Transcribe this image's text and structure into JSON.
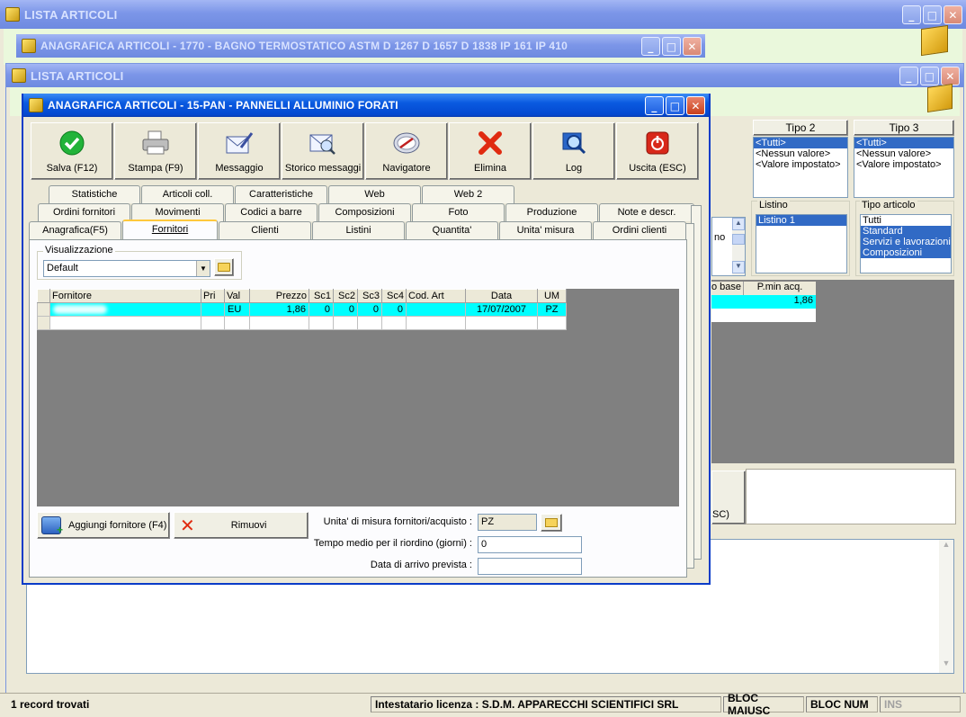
{
  "window_back": {
    "title": "LISTA ARTICOLI"
  },
  "window_mid": {
    "title": "ANAGRAFICA ARTICOLI - 1770 - BAGNO TERMOSTATICO ASTM D 1267 D 1657 D 1838 IP 161 IP 410"
  },
  "window_list": {
    "title": "LISTA ARTICOLI",
    "tipo2": {
      "label": "Tipo 2",
      "items": [
        "<Tutti>",
        "<Nessun valore>",
        "<Valore impostato>"
      ],
      "selected": 0
    },
    "tipo3": {
      "label": "Tipo 3",
      "items": [
        "<Tutti>",
        "<Nessun valore>",
        "<Valore impostato>"
      ],
      "selected": 0
    },
    "listino": {
      "label": "Listino",
      "items": [
        "Listino 1"
      ]
    },
    "tipo_articolo": {
      "label": "Tipo articolo",
      "items": [
        "Tutti",
        "Standard",
        "Servizi e lavorazioni",
        "Composizioni"
      ]
    },
    "partial_text": "no",
    "grid_headers": [
      "o base",
      "P.min acq."
    ],
    "grid_value": "1,86",
    "partial_button": "SC)"
  },
  "window_front": {
    "title": "ANAGRAFICA ARTICOLI - 15-PAN - PANNELLI ALLUMINIO FORATI",
    "toolbar": [
      {
        "label": "Salva (F12)",
        "icon": "check-icon"
      },
      {
        "label": "Stampa (F9)",
        "icon": "printer-icon"
      },
      {
        "label": "Messaggio",
        "icon": "envelope-pen-icon"
      },
      {
        "label": "Storico messaggi",
        "icon": "envelope-search-icon"
      },
      {
        "label": "Navigatore",
        "icon": "compass-icon"
      },
      {
        "label": "Elimina",
        "icon": "delete-x-icon"
      },
      {
        "label": "Log",
        "icon": "log-search-icon"
      },
      {
        "label": "Uscita (ESC)",
        "icon": "power-icon"
      }
    ],
    "tabs_row1": [
      "Statistiche",
      "Articoli coll.",
      "Caratteristiche",
      "Web",
      "Web 2"
    ],
    "tabs_row2": [
      "Ordini fornitori",
      "Movimenti",
      "Codici a barre",
      "Composizioni",
      "Foto",
      "Produzione",
      "Note e descr."
    ],
    "tabs_row3": [
      "Anagrafica(F5)",
      "Fornitori",
      "Clienti",
      "Listini",
      "Quantita'",
      "Unita' misura",
      "Ordini clienti"
    ],
    "active_tab": "Fornitori",
    "visualizzazione": {
      "label": "Visualizzazione",
      "value": "Default"
    },
    "grid": {
      "headers": [
        "Fornitore",
        "Pri",
        "Val",
        "Prezzo",
        "Sc1",
        "Sc2",
        "Sc3",
        "Sc4",
        "Cod. Art",
        "Data",
        "UM"
      ],
      "rows": [
        [
          "",
          "",
          "EU",
          "1,86",
          "0",
          "0",
          "0",
          "0",
          "",
          "17/07/2007",
          "PZ"
        ]
      ]
    },
    "add_button": "Aggiungi fornitore (F4)",
    "remove_button": "Rimuovi",
    "um_label": "Unita' di misura fornitori/acquisto :",
    "um_value": "PZ",
    "tempo_label": "Tempo medio per il riordino (giorni) :",
    "tempo_value": "0",
    "arrivo_label": "Data di arrivo prevista :",
    "arrivo_value": ""
  },
  "statusbar": {
    "records": "1 record trovati",
    "license": "Intestatario licenza : S.D.M. APPARECCHI SCIENTIFICI SRL",
    "caps": "BLOC MAIUSC",
    "num": "BLOC NUM",
    "ins": "INS"
  }
}
